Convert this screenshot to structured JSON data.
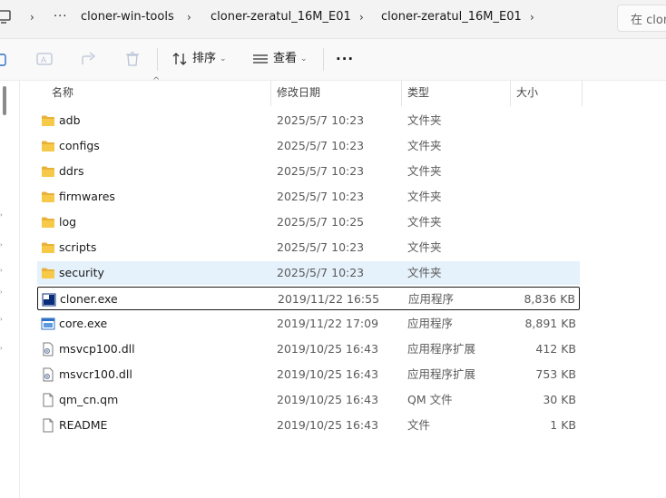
{
  "breadcrumb": {
    "overflow": "···",
    "items": [
      "cloner-win-tools",
      "cloner-zeratul_16M_E01",
      "cloner-zeratul_16M_E01"
    ]
  },
  "search": {
    "placeholder": "在 clon"
  },
  "toolbar": {
    "sort_label": "排序",
    "view_label": "查看",
    "more_label": "···"
  },
  "columns": {
    "name": "名称",
    "date": "修改日期",
    "type": "类型",
    "size": "大小"
  },
  "files": [
    {
      "name": "adb",
      "date": "2025/5/7 10:23",
      "type": "文件夹",
      "size": "",
      "icon": "folder-icon"
    },
    {
      "name": "configs",
      "date": "2025/5/7 10:23",
      "type": "文件夹",
      "size": "",
      "icon": "folder-icon"
    },
    {
      "name": "ddrs",
      "date": "2025/5/7 10:23",
      "type": "文件夹",
      "size": "",
      "icon": "folder-icon"
    },
    {
      "name": "firmwares",
      "date": "2025/5/7 10:23",
      "type": "文件夹",
      "size": "",
      "icon": "folder-icon"
    },
    {
      "name": "log",
      "date": "2025/5/7 10:25",
      "type": "文件夹",
      "size": "",
      "icon": "folder-icon"
    },
    {
      "name": "scripts",
      "date": "2025/5/7 10:23",
      "type": "文件夹",
      "size": "",
      "icon": "folder-icon"
    },
    {
      "name": "security",
      "date": "2025/5/7 10:23",
      "type": "文件夹",
      "size": "",
      "icon": "folder-icon",
      "state": "selected"
    },
    {
      "name": "cloner.exe",
      "date": "2019/11/22 16:55",
      "type": "应用程序",
      "size": "8,836 KB",
      "icon": "cloner-app-icon",
      "state": "focused"
    },
    {
      "name": "core.exe",
      "date": "2019/11/22 17:09",
      "type": "应用程序",
      "size": "8,891 KB",
      "icon": "exe-window-icon"
    },
    {
      "name": "msvcp100.dll",
      "date": "2019/10/25 16:43",
      "type": "应用程序扩展",
      "size": "412 KB",
      "icon": "dll-file-icon"
    },
    {
      "name": "msvcr100.dll",
      "date": "2019/10/25 16:43",
      "type": "应用程序扩展",
      "size": "753 KB",
      "icon": "dll-file-icon"
    },
    {
      "name": "qm_cn.qm",
      "date": "2019/10/25 16:43",
      "type": "QM 文件",
      "size": "30 KB",
      "icon": "blank-file-icon"
    },
    {
      "name": "README",
      "date": "2019/10/25 16:43",
      "type": "文件",
      "size": "1 KB",
      "icon": "blank-file-icon"
    }
  ],
  "colors": {
    "folder": "#f7c948",
    "selection": "#e5f1fb",
    "accent": "#0a2d7a"
  }
}
